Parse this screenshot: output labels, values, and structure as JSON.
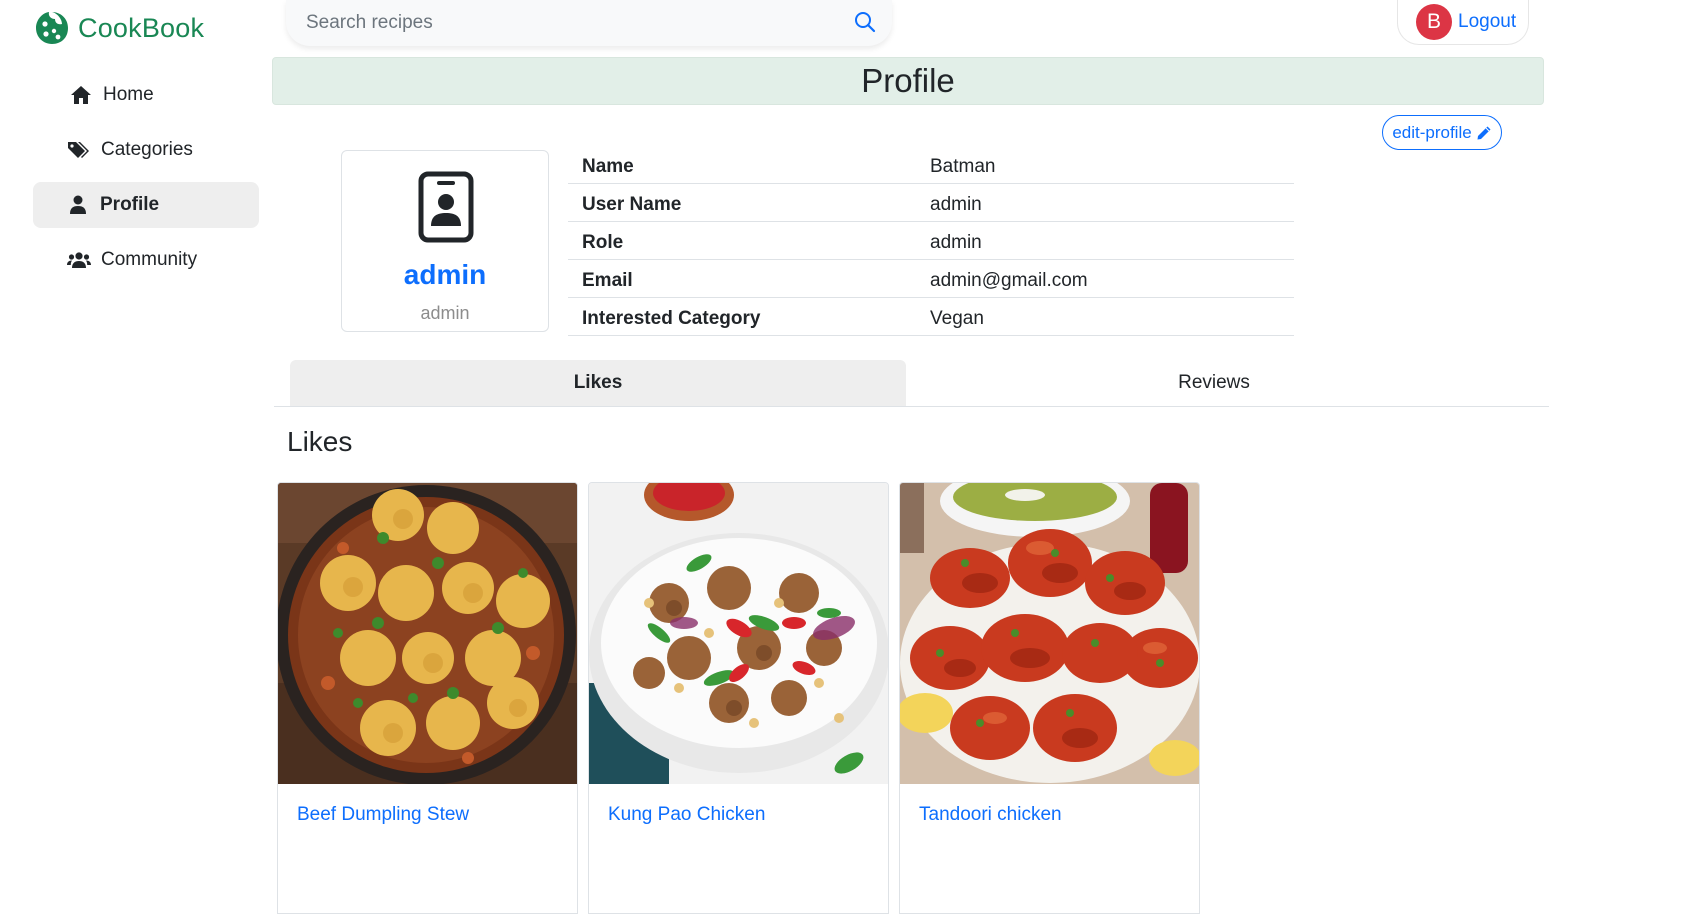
{
  "brand": {
    "name": "CookBook",
    "color": "#198754"
  },
  "sidebar": {
    "items": [
      {
        "label": "Home",
        "icon": "home-icon",
        "active": false
      },
      {
        "label": "Categories",
        "icon": "tags-icon",
        "active": false
      },
      {
        "label": "Profile",
        "icon": "user-icon",
        "active": true
      },
      {
        "label": "Community",
        "icon": "users-icon",
        "active": false
      }
    ]
  },
  "header": {
    "search_placeholder": "Search recipes",
    "avatar_initial": "B",
    "logout_label": "Logout"
  },
  "page": {
    "title": "Profile",
    "edit_label": "edit-profile"
  },
  "profile_card": {
    "username": "admin",
    "role": "admin"
  },
  "details": [
    {
      "key": "Name",
      "value": "Batman"
    },
    {
      "key": "User Name",
      "value": "admin"
    },
    {
      "key": "Role",
      "value": "admin"
    },
    {
      "key": "Email",
      "value": "admin@gmail.com"
    },
    {
      "key": "Interested Category",
      "value": "Vegan"
    }
  ],
  "tabs": {
    "likes": "Likes",
    "reviews": "Reviews",
    "active": "likes"
  },
  "section": {
    "heading": "Likes"
  },
  "recipes": [
    {
      "title": "Beef Dumpling Stew"
    },
    {
      "title": "Kung Pao Chicken"
    },
    {
      "title": "Tandoori chicken"
    }
  ],
  "colors": {
    "accent": "#0d6efd",
    "brand": "#198754",
    "title_bar": "#e2efe8",
    "avatar": "#dc3545"
  }
}
